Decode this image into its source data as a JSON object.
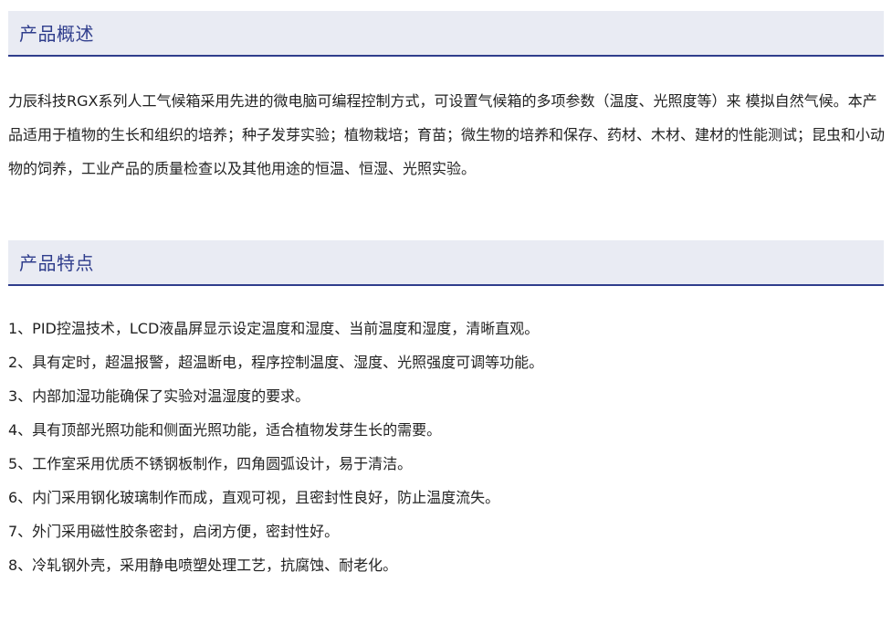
{
  "overview": {
    "title": "产品概述",
    "text": "力辰科技RGX系列人工气候箱采用先进的微电脑可编程控制方式，可设置气候箱的多项参数（温度、光照度等）来 模拟自然气候。本产品适用于植物的生长和组织的培养；种子发芽实验；植物栽培；育苗；微生物的培养和保存、药材、木材、建材的性能测试；昆虫和小动物的饲养，工业产品的质量检查以及其他用途的恒温、恒湿、光照实验。"
  },
  "features": {
    "title": "产品特点",
    "items": [
      "1、PID控温技术，LCD液晶屏显示设定温度和湿度、当前温度和湿度，清晰直观。",
      "2、具有定时，超温报警，超温断电，程序控制温度、湿度、光照强度可调等功能。",
      "3、内部加湿功能确保了实验对温湿度的要求。",
      "4、具有顶部光照功能和侧面光照功能，适合植物发芽生长的需要。",
      "5、工作室采用优质不锈钢板制作，四角圆弧设计，易于清洁。",
      "6、内门采用钢化玻璃制作而成，直观可视，且密封性良好，防止温度流失。",
      "7、外门采用磁性胶条密封，启闭方便，密封性好。",
      "8、冷轧钢外壳，采用静电喷塑处理工艺，抗腐蚀、耐老化。"
    ]
  },
  "colors": {
    "header_background": "#e9ebf3",
    "header_accent": "#2f3d8c",
    "body_text": "#222222"
  }
}
